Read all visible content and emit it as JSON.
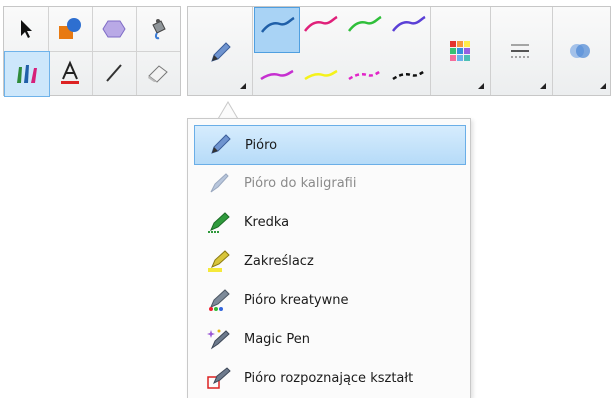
{
  "left_tools": [
    {
      "name": "select-tool",
      "icon": "arrow-pointer-icon"
    },
    {
      "name": "shapes-tool",
      "icon": "shapes-icon"
    },
    {
      "name": "regular-polygon-tool",
      "icon": "polygon-icon"
    },
    {
      "name": "fill-tool",
      "icon": "paint-bucket-icon"
    },
    {
      "name": "pens-tool",
      "icon": "pens-icon"
    },
    {
      "name": "text-tool",
      "icon": "text-a-icon"
    },
    {
      "name": "line-tool",
      "icon": "line-icon"
    },
    {
      "name": "eraser-tool",
      "icon": "eraser-icon"
    }
  ],
  "pen_swatches": [
    {
      "color": "#1f5fa8",
      "selected": true
    },
    {
      "color": "#e0207a",
      "selected": false
    },
    {
      "color": "#2fbf3a",
      "selected": false
    },
    {
      "color": "#5a3fd6",
      "selected": false
    },
    {
      "color": "#c62fd0",
      "selected": false
    },
    {
      "color": "#f5f21a",
      "selected": false
    },
    {
      "color": "#e224c8",
      "selected": false
    },
    {
      "color": "#111111",
      "selected": false
    }
  ],
  "menu": {
    "items": [
      {
        "label": "Pióro",
        "icon": "pen-icon",
        "selected": true,
        "disabled": false
      },
      {
        "label": "Pióro do kaligrafii",
        "icon": "calligraphy-pen-icon",
        "selected": false,
        "disabled": true
      },
      {
        "label": "Kredka",
        "icon": "crayon-icon",
        "selected": false,
        "disabled": false
      },
      {
        "label": "Zakreślacz",
        "icon": "highlighter-icon",
        "selected": false,
        "disabled": false
      },
      {
        "label": "Pióro kreatywne",
        "icon": "creative-pen-icon",
        "selected": false,
        "disabled": false
      },
      {
        "label": "Magic Pen",
        "icon": "magic-pen-icon",
        "selected": false,
        "disabled": false
      },
      {
        "label": "Pióro rozpoznające kształt",
        "icon": "shape-recognition-pen-icon",
        "selected": false,
        "disabled": false
      }
    ]
  }
}
